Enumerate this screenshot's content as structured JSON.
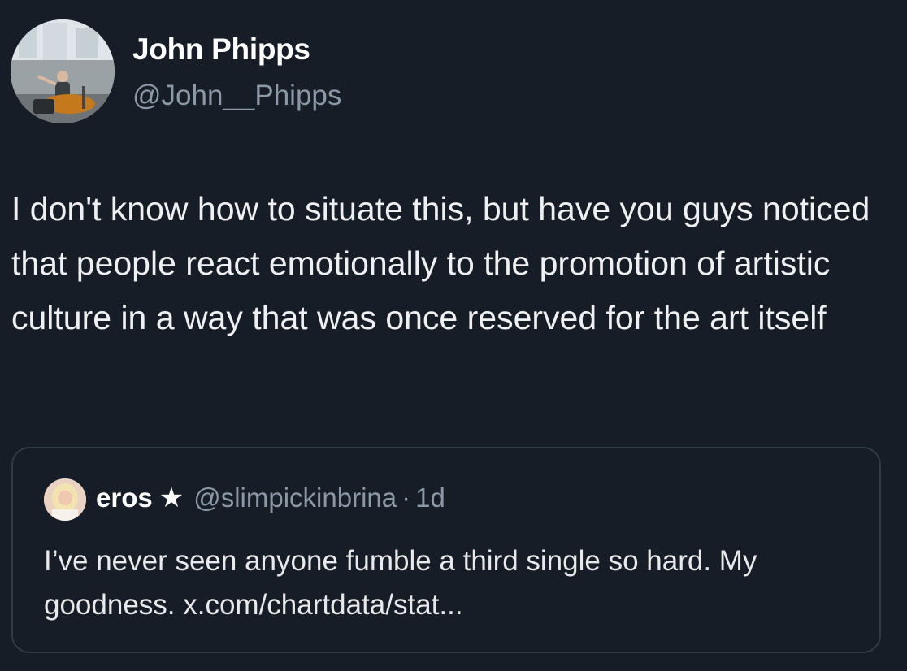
{
  "author": {
    "name": "John Phipps",
    "handle": "@John__Phipps"
  },
  "tweet": {
    "text": "I don't know how to situate this, but have you guys noticed that people react emotionally to the promotion of artistic culture in a way that was once reserved for the art itself"
  },
  "quote": {
    "name": "eros",
    "badge_icon": "star-icon",
    "handle": "@slimpickinbrina",
    "separator": "·",
    "time": "1d",
    "text": "I’ve never seen anyone fumble a third single so hard. My goodness. x.com/chartdata/stat..."
  },
  "colors": {
    "background": "#161d27",
    "text_primary": "#e7e9ea",
    "text_secondary": "#8b98a5",
    "card_border": "#323a45"
  }
}
